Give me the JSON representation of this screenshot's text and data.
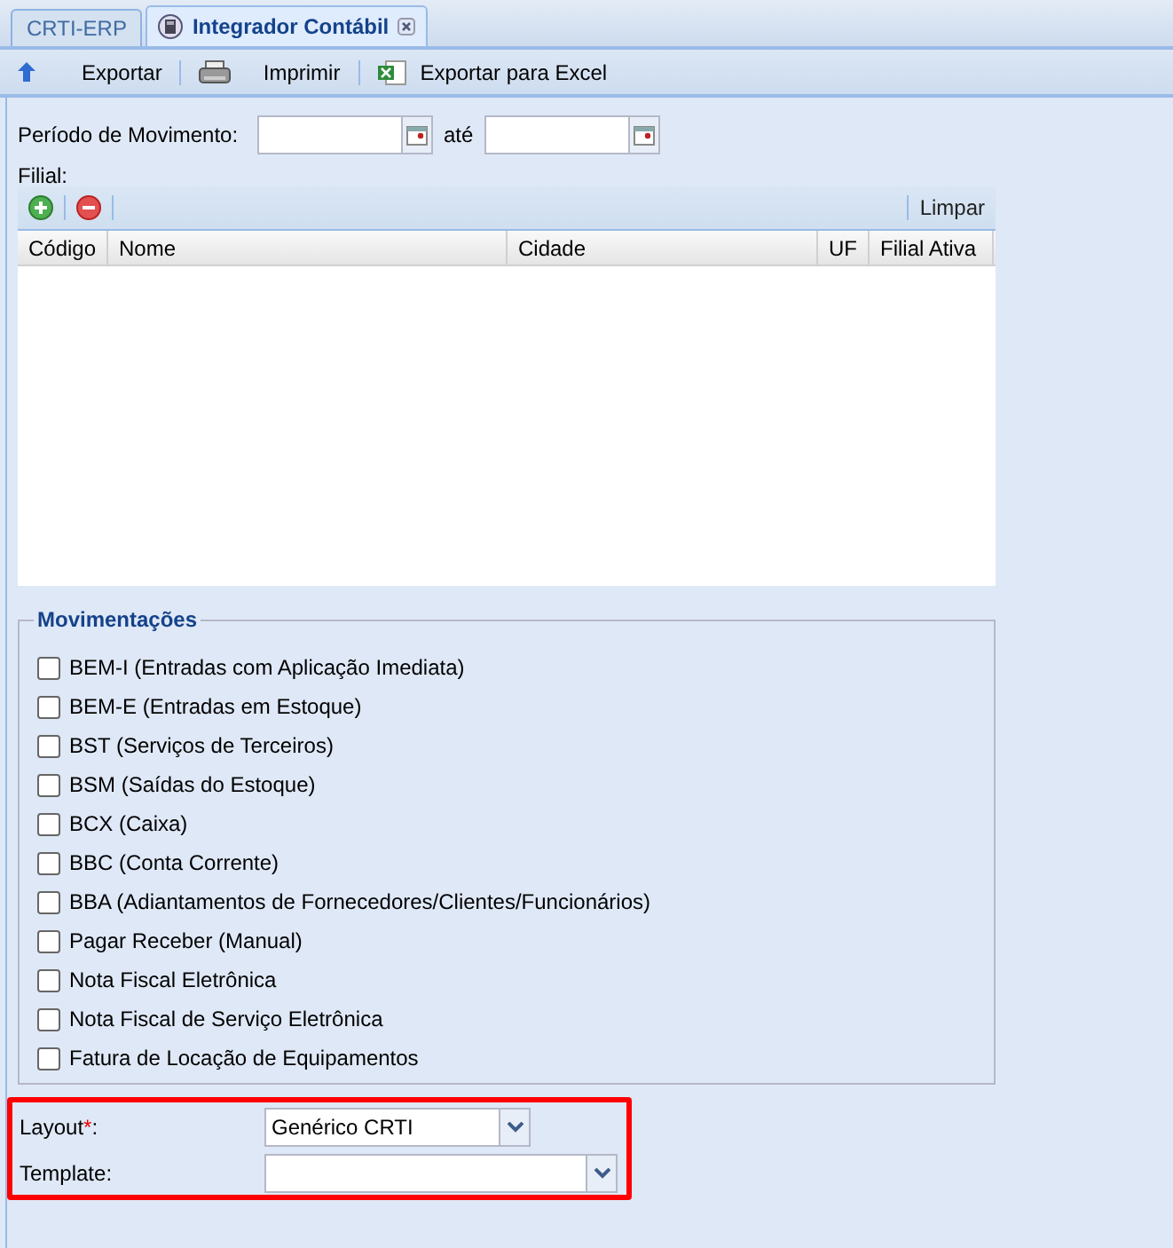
{
  "tabs": [
    {
      "label": "CRTI-ERP",
      "selected": false,
      "closable": false
    },
    {
      "label": "Integrador Contábil",
      "selected": true,
      "closable": true
    }
  ],
  "toolbar": [
    {
      "label": "Exportar",
      "kind": "arrow"
    },
    {
      "label": "Imprimir",
      "kind": "printer"
    },
    {
      "label": "Exportar para Excel",
      "kind": "excel"
    }
  ],
  "period": {
    "label": "Período de Movimento:",
    "separator": "até"
  },
  "filial": {
    "label": "Filial:",
    "clear_label": "Limpar",
    "columns": [
      "Código",
      "Nome",
      "Cidade",
      "UF",
      "Filial Ativa"
    ]
  },
  "movimentacoes": {
    "legend": "Movimentações",
    "items": [
      {
        "label": "BEM-I (Entradas com Aplicação Imediata)",
        "checked": false
      },
      {
        "label": "BEM-E (Entradas em Estoque)",
        "checked": false
      },
      {
        "label": "BST (Serviços de Terceiros)",
        "checked": false
      },
      {
        "label": "BSM (Saídas do Estoque)",
        "checked": false
      },
      {
        "label": "BCX (Caixa)",
        "checked": false
      },
      {
        "label": "BBC (Conta Corrente)",
        "checked": false
      },
      {
        "label": "BBA (Adiantamentos de Fornecedores/Clientes/Funcionários)",
        "checked": false
      },
      {
        "label": "Pagar Receber (Manual)",
        "checked": false
      },
      {
        "label": "Nota Fiscal Eletrônica",
        "checked": false
      },
      {
        "label": "Nota Fiscal de Serviço Eletrônica",
        "checked": false
      },
      {
        "label": "Fatura de Locação de Equipamentos",
        "checked": false
      }
    ]
  },
  "layout": {
    "label": "Layout",
    "required_mark": "*",
    "label_suffix": ":",
    "value": "Genérico CRTI"
  },
  "template": {
    "label": "Template:"
  }
}
